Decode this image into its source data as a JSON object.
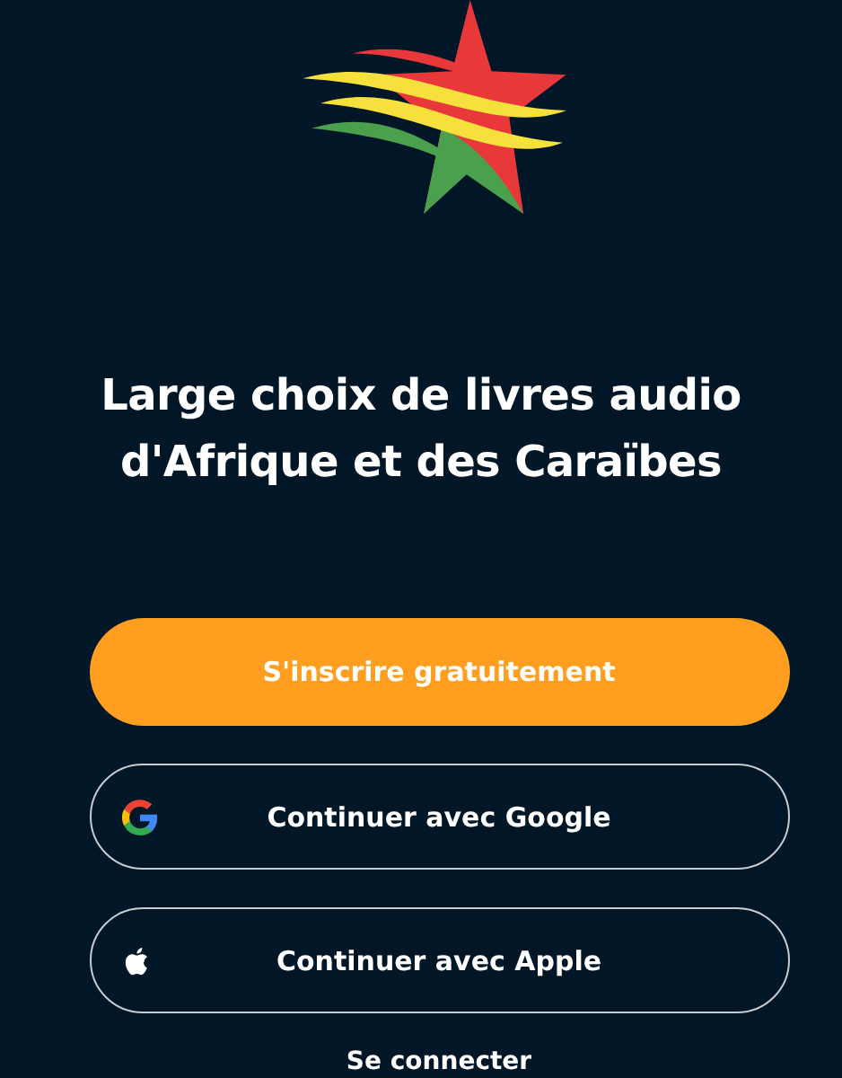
{
  "headline": "Large choix de livres audio d'Afrique et des Caraïbes",
  "buttons": [
    {
      "kind": "primary",
      "label": "S'inscrire gratuitement"
    },
    {
      "kind": "google",
      "label": "Continuer avec Google"
    },
    {
      "kind": "apple",
      "label": "Continuer avec Apple"
    }
  ],
  "login_link": "Se connecter"
}
